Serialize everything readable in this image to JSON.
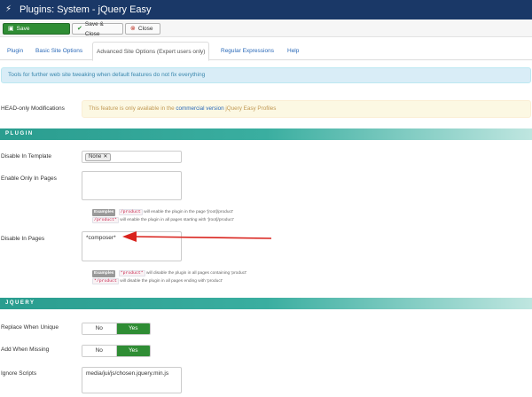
{
  "window": {
    "title": "Plugins: System - jQuery Easy",
    "icon": "plug-icon"
  },
  "toolbar": {
    "save_label": "Save",
    "save_close_label": "Save & Close",
    "close_label": "Close"
  },
  "tabs": [
    {
      "label": "Plugin"
    },
    {
      "label": "Basic Site Options"
    },
    {
      "label": "Advanced Site Options (Expert users only)"
    },
    {
      "label": "Regular Expressions"
    },
    {
      "label": "Help"
    }
  ],
  "info_message": "Tools for further web site tweaking when default features do not fix everything",
  "head_only": {
    "label": "HEAD-only Modifications",
    "notice_prefix": "This feature is only available in the",
    "notice_link": "commercial version",
    "notice_suffix": "jQuery Easy Profiles"
  },
  "sections": {
    "plugin": "PLUGIN",
    "jquery": "JQUERY"
  },
  "fields": {
    "disable_in_template": {
      "label": "Disable In Template",
      "chip": "None"
    },
    "enable_only_in_pages": {
      "label": "Enable Only In Pages",
      "value": ""
    },
    "disable_in_pages": {
      "label": "Disable In Pages",
      "value": "*composer*"
    },
    "replace_when_unique": {
      "label": "Replace When Unique",
      "no": "No",
      "yes": "Yes",
      "selected": "Yes"
    },
    "add_when_missing": {
      "label": "Add When Missing",
      "no": "No",
      "yes": "Yes",
      "selected": "Yes"
    },
    "ignore_scripts": {
      "label": "Ignore Scripts",
      "value": "media/jui/js/chosen.jquery.min.js"
    }
  },
  "examples": {
    "badge": "Examples",
    "enable": [
      {
        "code": "/product",
        "text": "will enable the plugin in the page '[root]/product'"
      },
      {
        "code": "/product*",
        "text": "will enable the plugin in all pages starting with '[root]/product'"
      }
    ],
    "disable": [
      {
        "code": "*product*",
        "text": "will disable the plugin in all pages containing 'product'"
      },
      {
        "code": "*/product",
        "text": "will disable the plugin in all pages ending with 'product'"
      }
    ]
  },
  "colors": {
    "header_bg": "#1a3867",
    "save_green": "#2f8d34",
    "section_teal": "#2a9d8f",
    "arrow_red": "#d9231d"
  }
}
